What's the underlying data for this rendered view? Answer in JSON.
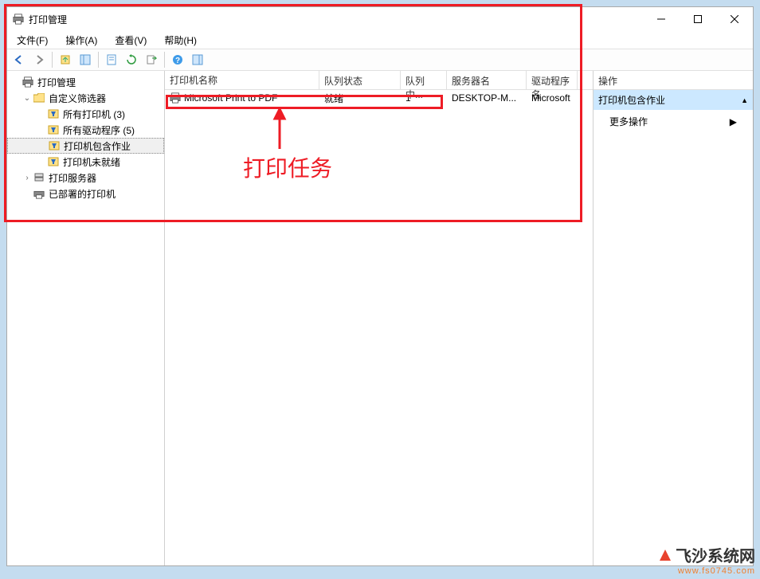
{
  "window": {
    "title": "打印管理"
  },
  "menu": {
    "file": "文件(F)",
    "action": "操作(A)",
    "view": "查看(V)",
    "help": "帮助(H)"
  },
  "tree": {
    "root": "打印管理",
    "customFilters": "自定义筛选器",
    "allPrinters": "所有打印机 (3)",
    "allDrivers": "所有驱动程序 (5)",
    "printersWithJobs": "打印机包含作业",
    "printersNotReady": "打印机未就绪",
    "printServers": "打印服务器",
    "deployedPrinters": "已部署的打印机"
  },
  "listHeader": {
    "name": "打印机名称",
    "queueStatus": "队列状态",
    "jobsInQueue": "队列中...",
    "serverName": "服务器名",
    "driverName": "驱动程序名"
  },
  "listRow": {
    "name": "Microsoft Print to PDF",
    "queueStatus": "就绪",
    "jobsInQueue": "1",
    "serverName": "DESKTOP-M...",
    "driverName": "Microsoft"
  },
  "actions": {
    "header": "操作",
    "selected": "打印机包含作业",
    "more": "更多操作"
  },
  "annotation": {
    "label": "打印任务"
  },
  "watermark": {
    "brand": "飞沙系统网",
    "url": "www.fs0745.com"
  }
}
